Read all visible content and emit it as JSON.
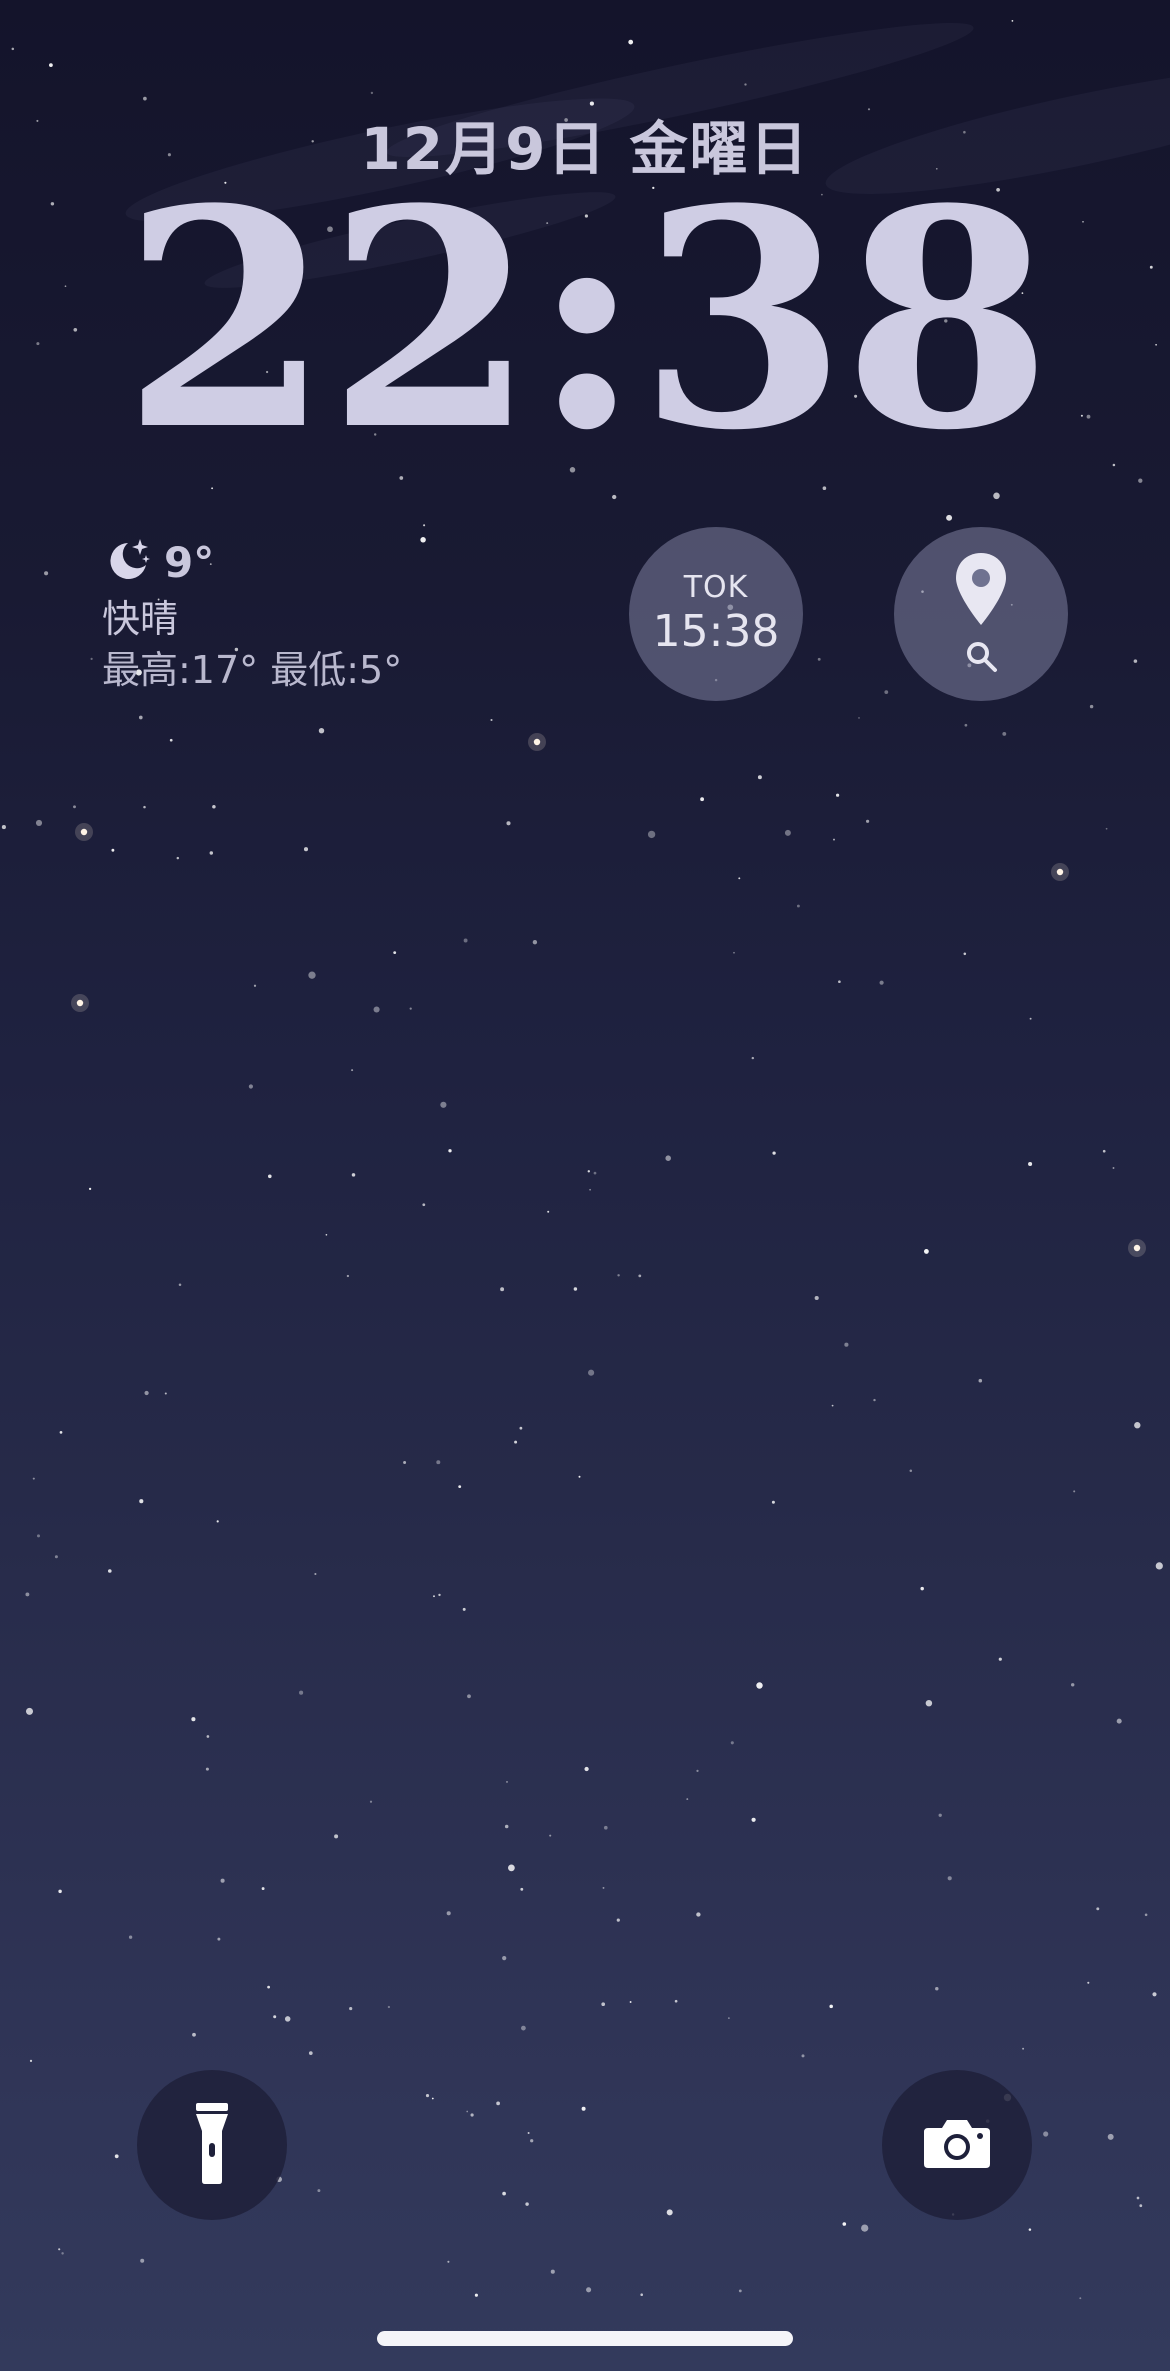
{
  "lock_screen": {
    "date": "12月9日 金曜日",
    "time": "22:38"
  },
  "weather_widget": {
    "icon": "moon-stars-icon",
    "temperature": "9°",
    "condition": "快晴",
    "range": "最高:17° 最低:5°"
  },
  "world_clock_widget": {
    "city": "TOK",
    "time": "15:38"
  },
  "maps_widget": {
    "icons": [
      "location-pin-icon",
      "search-icon"
    ]
  },
  "quick_actions": {
    "left_icon": "flashlight-icon",
    "right_icon": "camera-icon"
  },
  "colors": {
    "text_primary": "#cfcde4",
    "widget_bg": "#7d809e",
    "sky_top": "#14142b",
    "sky_bottom": "#333a5c"
  }
}
